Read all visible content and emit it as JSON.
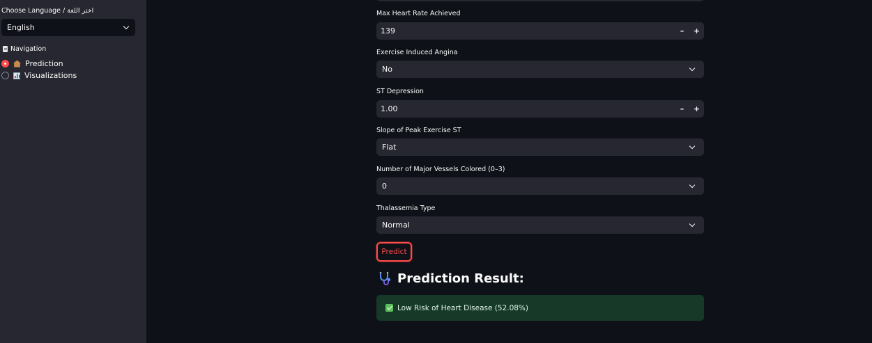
{
  "sidebar": {
    "language_label": "Choose Language / اختر اللغة",
    "language_selected": "English",
    "navigation_title": "Navigation",
    "nav_items": [
      {
        "label": "Prediction",
        "selected": true,
        "icon": "house-icon"
      },
      {
        "label": "Visualizations",
        "selected": false,
        "icon": "bar-chart-icon"
      }
    ]
  },
  "form": {
    "max_heart_rate": {
      "label": "Max Heart Rate Achieved",
      "value": "139"
    },
    "exercise_angina": {
      "label": "Exercise Induced Angina",
      "value": "No"
    },
    "st_depression": {
      "label": "ST Depression",
      "value": "1.00"
    },
    "slope": {
      "label": "Slope of Peak Exercise ST",
      "value": "Flat"
    },
    "vessels": {
      "label": "Number of Major Vessels Colored (0–3)",
      "value": "0"
    },
    "thalassemia": {
      "label": "Thalassemia Type",
      "value": "Normal"
    },
    "stepper_minus": "–",
    "stepper_plus": "+"
  },
  "predict_button": "Predict",
  "result": {
    "title": "Prediction Result:",
    "icon": "stethoscope-icon",
    "message": "Low Risk of Heart Disease (52.08%)"
  },
  "colors": {
    "accent": "#ff4b4b",
    "background": "#0e1117",
    "sidebar": "#262730",
    "success_bg": "#173928"
  }
}
